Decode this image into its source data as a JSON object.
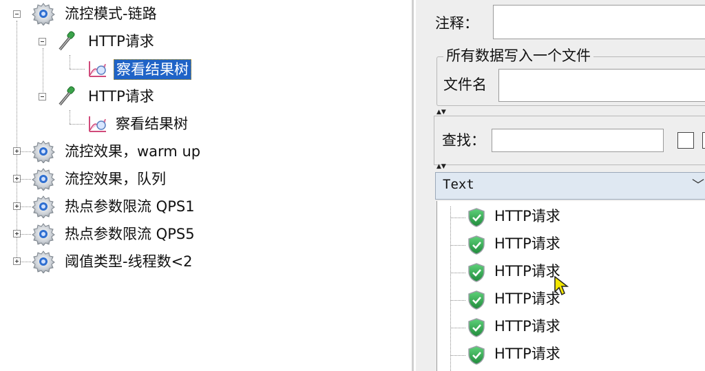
{
  "tree": {
    "nodes": [
      {
        "label": "流控模式-链路",
        "icon": "gear-icon",
        "expander": "minus"
      },
      {
        "label": "HTTP请求",
        "icon": "dropper-icon",
        "expander": "minus"
      },
      {
        "label": "察看结果树",
        "icon": "chart-icon",
        "selected": true
      },
      {
        "label": "HTTP请求",
        "icon": "dropper-icon",
        "expander": "minus"
      },
      {
        "label": "察看结果树",
        "icon": "chart-icon"
      },
      {
        "label": "流控效果，warm up",
        "icon": "gear-icon",
        "expander": "plus"
      },
      {
        "label": "流控效果，队列",
        "icon": "gear-icon",
        "expander": "plus"
      },
      {
        "label": "热点参数限流 QPS1",
        "icon": "gear-icon",
        "expander": "plus"
      },
      {
        "label": "热点参数限流 QPS5",
        "icon": "gear-icon",
        "expander": "plus"
      },
      {
        "label": "阈值类型-线程数<2",
        "icon": "gear-icon",
        "expander": "plus"
      }
    ]
  },
  "panel": {
    "comment_label": "注释：",
    "comment_value": "",
    "group_title": "所有数据写入一个文件",
    "filename_label": "文件名",
    "filename_value": "",
    "search_label": "查找：",
    "search_value": "",
    "renderer_selected": "Text",
    "results": [
      {
        "label": "HTTP请求",
        "status": "success"
      },
      {
        "label": "HTTP请求",
        "status": "success"
      },
      {
        "label": "HTTP请求",
        "status": "success"
      },
      {
        "label": "HTTP请求",
        "status": "success"
      },
      {
        "label": "HTTP请求",
        "status": "success"
      },
      {
        "label": "HTTP请求",
        "status": "success"
      }
    ]
  },
  "colors": {
    "selection": "#1f63c7",
    "panel_bg": "#eeeeee",
    "combo_bg": "#dfe8f2",
    "success_green": "#2fa84f"
  }
}
